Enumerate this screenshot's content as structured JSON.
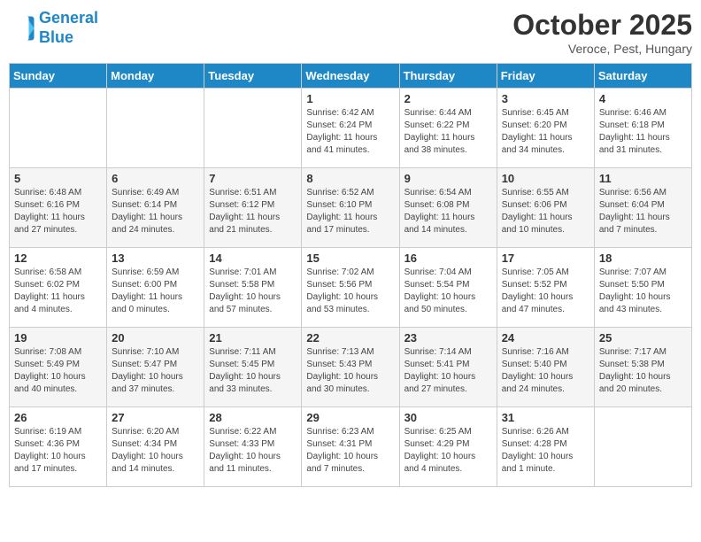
{
  "header": {
    "logo_line1": "General",
    "logo_line2": "Blue",
    "month": "October 2025",
    "location": "Veroce, Pest, Hungary"
  },
  "days_of_week": [
    "Sunday",
    "Monday",
    "Tuesday",
    "Wednesday",
    "Thursday",
    "Friday",
    "Saturday"
  ],
  "weeks": [
    [
      {
        "day": "",
        "info": ""
      },
      {
        "day": "",
        "info": ""
      },
      {
        "day": "",
        "info": ""
      },
      {
        "day": "1",
        "info": "Sunrise: 6:42 AM\nSunset: 6:24 PM\nDaylight: 11 hours\nand 41 minutes."
      },
      {
        "day": "2",
        "info": "Sunrise: 6:44 AM\nSunset: 6:22 PM\nDaylight: 11 hours\nand 38 minutes."
      },
      {
        "day": "3",
        "info": "Sunrise: 6:45 AM\nSunset: 6:20 PM\nDaylight: 11 hours\nand 34 minutes."
      },
      {
        "day": "4",
        "info": "Sunrise: 6:46 AM\nSunset: 6:18 PM\nDaylight: 11 hours\nand 31 minutes."
      }
    ],
    [
      {
        "day": "5",
        "info": "Sunrise: 6:48 AM\nSunset: 6:16 PM\nDaylight: 11 hours\nand 27 minutes."
      },
      {
        "day": "6",
        "info": "Sunrise: 6:49 AM\nSunset: 6:14 PM\nDaylight: 11 hours\nand 24 minutes."
      },
      {
        "day": "7",
        "info": "Sunrise: 6:51 AM\nSunset: 6:12 PM\nDaylight: 11 hours\nand 21 minutes."
      },
      {
        "day": "8",
        "info": "Sunrise: 6:52 AM\nSunset: 6:10 PM\nDaylight: 11 hours\nand 17 minutes."
      },
      {
        "day": "9",
        "info": "Sunrise: 6:54 AM\nSunset: 6:08 PM\nDaylight: 11 hours\nand 14 minutes."
      },
      {
        "day": "10",
        "info": "Sunrise: 6:55 AM\nSunset: 6:06 PM\nDaylight: 11 hours\nand 10 minutes."
      },
      {
        "day": "11",
        "info": "Sunrise: 6:56 AM\nSunset: 6:04 PM\nDaylight: 11 hours\nand 7 minutes."
      }
    ],
    [
      {
        "day": "12",
        "info": "Sunrise: 6:58 AM\nSunset: 6:02 PM\nDaylight: 11 hours\nand 4 minutes."
      },
      {
        "day": "13",
        "info": "Sunrise: 6:59 AM\nSunset: 6:00 PM\nDaylight: 11 hours\nand 0 minutes."
      },
      {
        "day": "14",
        "info": "Sunrise: 7:01 AM\nSunset: 5:58 PM\nDaylight: 10 hours\nand 57 minutes."
      },
      {
        "day": "15",
        "info": "Sunrise: 7:02 AM\nSunset: 5:56 PM\nDaylight: 10 hours\nand 53 minutes."
      },
      {
        "day": "16",
        "info": "Sunrise: 7:04 AM\nSunset: 5:54 PM\nDaylight: 10 hours\nand 50 minutes."
      },
      {
        "day": "17",
        "info": "Sunrise: 7:05 AM\nSunset: 5:52 PM\nDaylight: 10 hours\nand 47 minutes."
      },
      {
        "day": "18",
        "info": "Sunrise: 7:07 AM\nSunset: 5:50 PM\nDaylight: 10 hours\nand 43 minutes."
      }
    ],
    [
      {
        "day": "19",
        "info": "Sunrise: 7:08 AM\nSunset: 5:49 PM\nDaylight: 10 hours\nand 40 minutes."
      },
      {
        "day": "20",
        "info": "Sunrise: 7:10 AM\nSunset: 5:47 PM\nDaylight: 10 hours\nand 37 minutes."
      },
      {
        "day": "21",
        "info": "Sunrise: 7:11 AM\nSunset: 5:45 PM\nDaylight: 10 hours\nand 33 minutes."
      },
      {
        "day": "22",
        "info": "Sunrise: 7:13 AM\nSunset: 5:43 PM\nDaylight: 10 hours\nand 30 minutes."
      },
      {
        "day": "23",
        "info": "Sunrise: 7:14 AM\nSunset: 5:41 PM\nDaylight: 10 hours\nand 27 minutes."
      },
      {
        "day": "24",
        "info": "Sunrise: 7:16 AM\nSunset: 5:40 PM\nDaylight: 10 hours\nand 24 minutes."
      },
      {
        "day": "25",
        "info": "Sunrise: 7:17 AM\nSunset: 5:38 PM\nDaylight: 10 hours\nand 20 minutes."
      }
    ],
    [
      {
        "day": "26",
        "info": "Sunrise: 6:19 AM\nSunset: 4:36 PM\nDaylight: 10 hours\nand 17 minutes."
      },
      {
        "day": "27",
        "info": "Sunrise: 6:20 AM\nSunset: 4:34 PM\nDaylight: 10 hours\nand 14 minutes."
      },
      {
        "day": "28",
        "info": "Sunrise: 6:22 AM\nSunset: 4:33 PM\nDaylight: 10 hours\nand 11 minutes."
      },
      {
        "day": "29",
        "info": "Sunrise: 6:23 AM\nSunset: 4:31 PM\nDaylight: 10 hours\nand 7 minutes."
      },
      {
        "day": "30",
        "info": "Sunrise: 6:25 AM\nSunset: 4:29 PM\nDaylight: 10 hours\nand 4 minutes."
      },
      {
        "day": "31",
        "info": "Sunrise: 6:26 AM\nSunset: 4:28 PM\nDaylight: 10 hours\nand 1 minute."
      },
      {
        "day": "",
        "info": ""
      }
    ]
  ]
}
